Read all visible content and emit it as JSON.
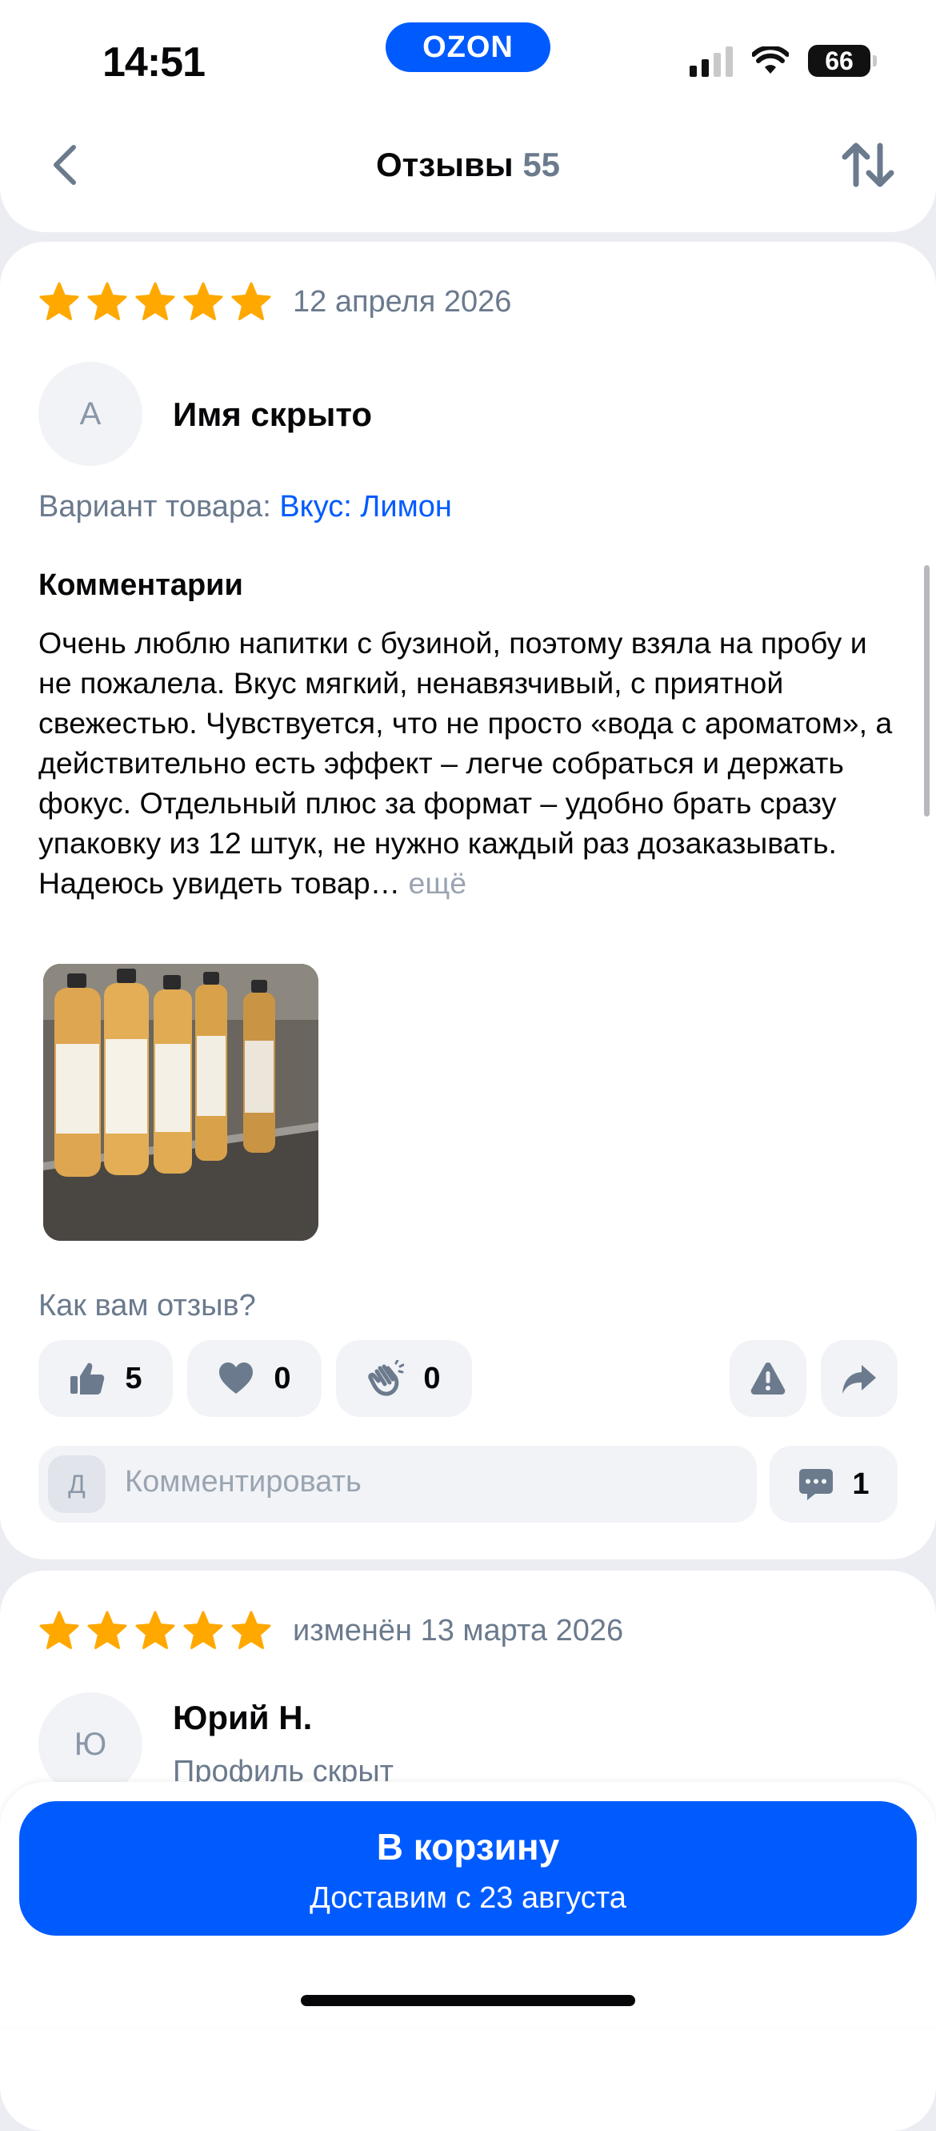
{
  "status_bar": {
    "time": "14:51",
    "battery": "66"
  },
  "brand": {
    "logo_text": "OZON",
    "color": "#005bff"
  },
  "header": {
    "title": "Отзывы",
    "count": "55"
  },
  "reviews": [
    {
      "rating": 5,
      "date": "12 апреля 2026",
      "avatar_letter": "А",
      "author": "Имя скрыто",
      "variant_label": "Вариант товара:",
      "variant_value": "Вкус: Лимон",
      "comment_heading": "Комментарии",
      "comment_text": "Очень люблю напитки с бузиной, поэтому взяла на пробу и не пожалела. Вкус мягкий, ненавязчивый, с приятной свежестью. Чувствуется, что не просто «вода с ароматом», а действительно есть эффект – легче собраться и держать фокус. Отдельный плюс за формат – удобно брать сразу упаковку из 12 штук, не нужно каждый раз дозаказывать. Надеюсь увидеть товар…",
      "more_label": "ещё",
      "helpful_question": "Как вам отзыв?",
      "likes": "5",
      "hearts": "0",
      "claps": "0",
      "comment_placeholder": "Комментировать",
      "commenter_letter": "Д",
      "comments_count": "1"
    },
    {
      "rating": 5,
      "date": "изменён 13 марта 2026",
      "avatar_letter": "Ю",
      "author": "Юрий Н.",
      "author_sub": "Профиль скрыт"
    }
  ],
  "cta": {
    "label": "В корзину",
    "sublabel": "Доставим с 23 августа"
  },
  "colors": {
    "star": "#ffa800",
    "accent": "#005bff",
    "muted": "#6b7a8d"
  }
}
